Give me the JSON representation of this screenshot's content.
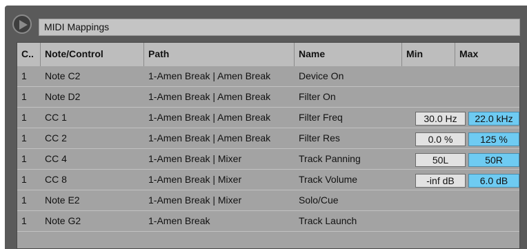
{
  "window": {
    "title": "MIDI Mappings"
  },
  "columns": {
    "channel": "C..",
    "note_control": "Note/Control",
    "path": "Path",
    "name": "Name",
    "min": "Min",
    "max": "Max"
  },
  "rows": [
    {
      "channel": "1",
      "note_control": "Note C2",
      "path": "1-Amen Break | Amen Break",
      "name": "Device On",
      "min": "",
      "max": ""
    },
    {
      "channel": "1",
      "note_control": "Note D2",
      "path": "1-Amen Break | Amen Break",
      "name": "Filter On",
      "min": "",
      "max": ""
    },
    {
      "channel": "1",
      "note_control": "CC 1",
      "path": "1-Amen Break | Amen Break",
      "name": "Filter Freq",
      "min": "30.0 Hz",
      "max": "22.0 kHz"
    },
    {
      "channel": "1",
      "note_control": "CC 2",
      "path": "1-Amen Break | Amen Break",
      "name": "Filter Res",
      "min": "0.0 %",
      "max": "125 %"
    },
    {
      "channel": "1",
      "note_control": "CC 4",
      "path": "1-Amen Break | Mixer",
      "name": "Track Panning",
      "min": "50L",
      "max": "50R"
    },
    {
      "channel": "1",
      "note_control": "CC 8",
      "path": "1-Amen Break | Mixer",
      "name": "Track Volume",
      "min": "-inf dB",
      "max": "6.0 dB"
    },
    {
      "channel": "1",
      "note_control": "Note E2",
      "path": "1-Amen Break | Mixer",
      "name": "Solo/Cue",
      "min": "",
      "max": ""
    },
    {
      "channel": "1",
      "note_control": "Note G2",
      "path": "1-Amen Break",
      "name": "Track Launch",
      "min": "",
      "max": ""
    }
  ],
  "colors": {
    "max_value_highlight": "#6ecbf2",
    "table_background": "#a3a3a3",
    "header_background": "#bdbdbd"
  },
  "icons": {
    "toggle": "play-triangle-icon"
  }
}
